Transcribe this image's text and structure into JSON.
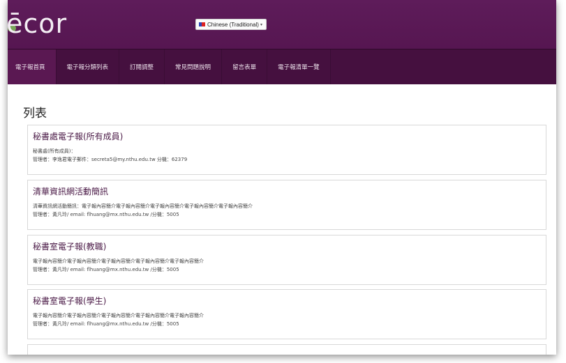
{
  "header": {
    "logo_text": "ēcor",
    "language": {
      "selected": "Chinese (Traditional)",
      "caret": "▾"
    }
  },
  "nav": {
    "items": [
      {
        "label": "電子報首頁"
      },
      {
        "label": "電子報分類列表"
      },
      {
        "label": "訂閱調整"
      },
      {
        "label": "常見問題說明"
      },
      {
        "label": "留言表單"
      },
      {
        "label": "電子報清單一覽"
      }
    ]
  },
  "main": {
    "title": "列表",
    "cards": [
      {
        "title": "秘書處電子報(所有成員)",
        "desc": "秘書處(所有成員)：",
        "admin": "管理者：李逸君電子郵件：secreta5@my.nthu.edu.tw 分機：62379"
      },
      {
        "title": "清華資訊網活動簡訊",
        "desc": "清華資訊網活動簡訊：電子報內容簡介電子報內容簡介電子報內容簡介電子報內容簡介電子報內容簡介",
        "admin": "管理者：黃凡玲/ email: flhuang@mx.nthu.edu.tw /分機：5005"
      },
      {
        "title": "秘書室電子報(教職)",
        "desc": "電子報內容簡介電子報內容簡介電子報內容簡介電子報內容簡介電子報內容簡介",
        "admin": "管理者：黃凡玲/ email: flhuang@mx.nthu.edu.tw /分機：5005"
      },
      {
        "title": "秘書室電子報(學生)",
        "desc": "電子報內容簡介電子報內容簡介電子報內容簡介電子報內容簡介電子報內容簡介",
        "admin": "管理者：黃凡玲/ email: flhuang@mx.nthu.edu.tw /分機：5005"
      }
    ]
  }
}
